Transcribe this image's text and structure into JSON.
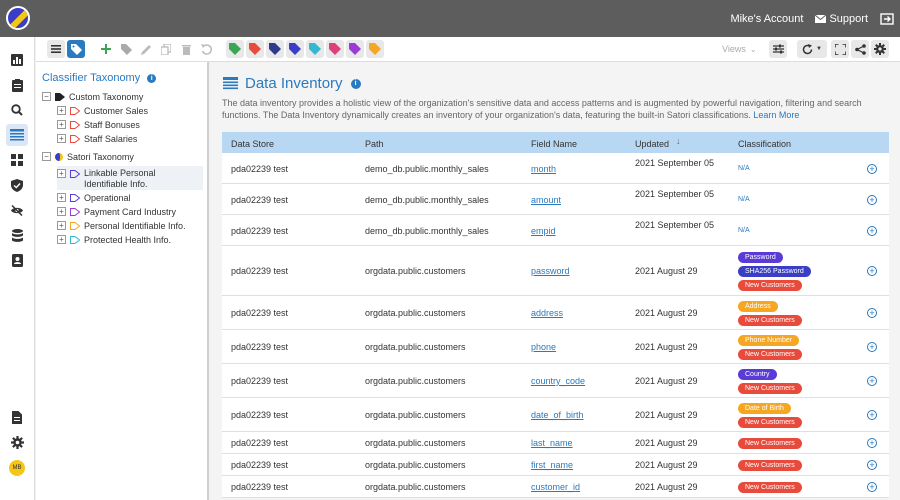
{
  "topbar": {
    "account_label": "Mike's Account",
    "support_label": "Support"
  },
  "leftnav": {
    "icons": [
      "dashboard-icon",
      "clipboard-icon",
      "search-icon",
      "data-inventory-icon",
      "grid-icon",
      "shield-icon",
      "eye-off-icon",
      "database-icon",
      "contacts-icon",
      "document-icon",
      "gear-icon"
    ],
    "avatar_initials": "MB"
  },
  "toolbar": {
    "views_label": "Views"
  },
  "tree": {
    "title": "Classifier Taxonomy",
    "custom_label": "Custom Taxonomy",
    "custom_items": [
      "Customer Sales",
      "Staff Bonuses",
      "Staff Salaries"
    ],
    "satori_label": "Satori Taxonomy",
    "satori_items": [
      {
        "line1": "Linkable Personal",
        "line2": "Identifiable Info."
      },
      {
        "line1": "Operational"
      },
      {
        "line1": "Payment Card Industry"
      },
      {
        "line1": "Personal Identifiable Info."
      },
      {
        "line1": "Protected Health Info."
      }
    ]
  },
  "main": {
    "title": "Data Inventory",
    "description": "The data inventory provides a holistic view of the organization's sensitive data and access patterns and is augmented by powerful navigation, filtering and search functions. The Data Inventory dynamically creates an inventory of your organization's data, featuring the built-in Satori classifications.",
    "learn_more": "Learn More"
  },
  "table": {
    "headers": {
      "data_store": "Data Store",
      "path": "Path",
      "field_name": "Field Name",
      "updated": "Updated",
      "classification": "Classification"
    },
    "rows": [
      {
        "store": "pda02239 test",
        "path": "demo_db.public.monthly_sales",
        "field": "month",
        "updated": "2021 September 05",
        "na": "N/A"
      },
      {
        "store": "pda02239 test",
        "path": "demo_db.public.monthly_sales",
        "field": "amount",
        "updated": "2021 September 05",
        "na": "N/A"
      },
      {
        "store": "pda02239 test",
        "path": "demo_db.public.monthly_sales",
        "field": "empid",
        "updated": "2021 September 05",
        "na": "N/A"
      },
      {
        "store": "pda02239 test",
        "path": "orgdata.public.customers",
        "field": "password",
        "updated": "2021 August 29",
        "badges": [
          "Password",
          "SHA256 Password",
          "New Customers"
        ]
      },
      {
        "store": "pda02239 test",
        "path": "orgdata.public.customers",
        "field": "address",
        "updated": "2021 August 29",
        "badges": [
          "Address",
          "New Customers"
        ]
      },
      {
        "store": "pda02239 test",
        "path": "orgdata.public.customers",
        "field": "phone",
        "updated": "2021 August 29",
        "badges": [
          "Phone Number",
          "New Customers"
        ]
      },
      {
        "store": "pda02239 test",
        "path": "orgdata.public.customers",
        "field": "country_code",
        "updated": "2021 August 29",
        "badges": [
          "Country",
          "New Customers"
        ]
      },
      {
        "store": "pda02239 test",
        "path": "orgdata.public.customers",
        "field": "date_of_birth",
        "updated": "2021 August 29",
        "badges": [
          "Date of Birth",
          "New Customers"
        ]
      },
      {
        "store": "pda02239 test",
        "path": "orgdata.public.customers",
        "field": "last_name",
        "updated": "2021 August 29",
        "badges": [
          "New Customers"
        ]
      },
      {
        "store": "pda02239 test",
        "path": "orgdata.public.customers",
        "field": "first_name",
        "updated": "2021 August 29",
        "badges": [
          "New Customers"
        ]
      },
      {
        "store": "pda02239 test",
        "path": "orgdata.public.customers",
        "field": "customer_id",
        "updated": "2021 August 29",
        "badges": [
          "New Customers"
        ]
      }
    ]
  },
  "colors": {
    "password": "#5b3bd6",
    "sha256": "#3a3ec7",
    "new_customers": "#e84b3c",
    "address": "#f5a623",
    "phone": "#f5a623",
    "country": "#5b3bd6",
    "dob": "#f5a623",
    "accent": "#2a7abf"
  }
}
